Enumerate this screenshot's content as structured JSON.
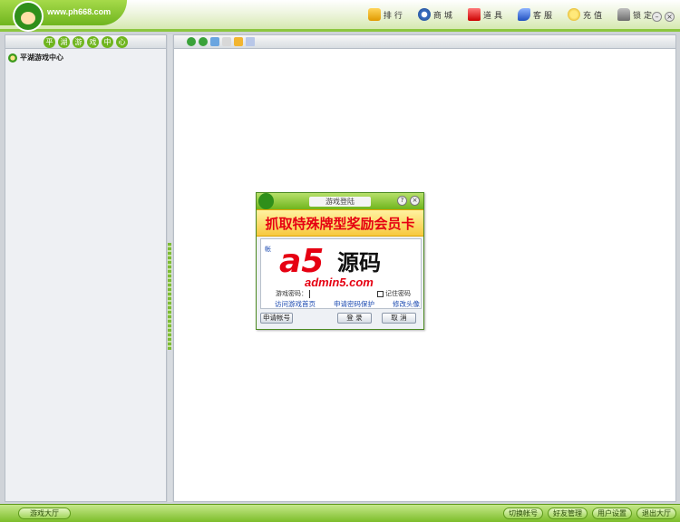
{
  "header": {
    "logo_url": "www.ph668.com",
    "nav": [
      {
        "label": "排行",
        "icon": "rank-icon"
      },
      {
        "label": "商城",
        "icon": "mall-icon"
      },
      {
        "label": "道具",
        "icon": "prop-icon"
      },
      {
        "label": "客服",
        "icon": "service-icon"
      },
      {
        "label": "充值",
        "icon": "charge-icon"
      },
      {
        "label": "锁定",
        "icon": "lock-icon"
      }
    ],
    "minimize": "–",
    "close": "×"
  },
  "left_panel": {
    "title_chars": [
      "平",
      "湖",
      "游",
      "戏",
      "中",
      "心"
    ],
    "tree_root": "平湖游戏中心"
  },
  "dialog": {
    "title": "游戏登陆",
    "help": "?",
    "close": "×",
    "banner": "抓取特殊牌型奖励会员卡",
    "tab_label": "帐",
    "password_label": "游戏密码：",
    "remember_label": "记住密码",
    "links": [
      "访问游戏首页",
      "申请密码保护",
      "修改头像"
    ],
    "apply_account": "申请帐号",
    "login": "登 录",
    "cancel": "取 消"
  },
  "watermark": {
    "logo": "a5",
    "chinese": "源码",
    "url": "admin5.com"
  },
  "statusbar": {
    "lobby": "游戏大厅",
    "buttons": [
      "切换帐号",
      "好友管理",
      "用户设置",
      "退出大厅"
    ]
  }
}
